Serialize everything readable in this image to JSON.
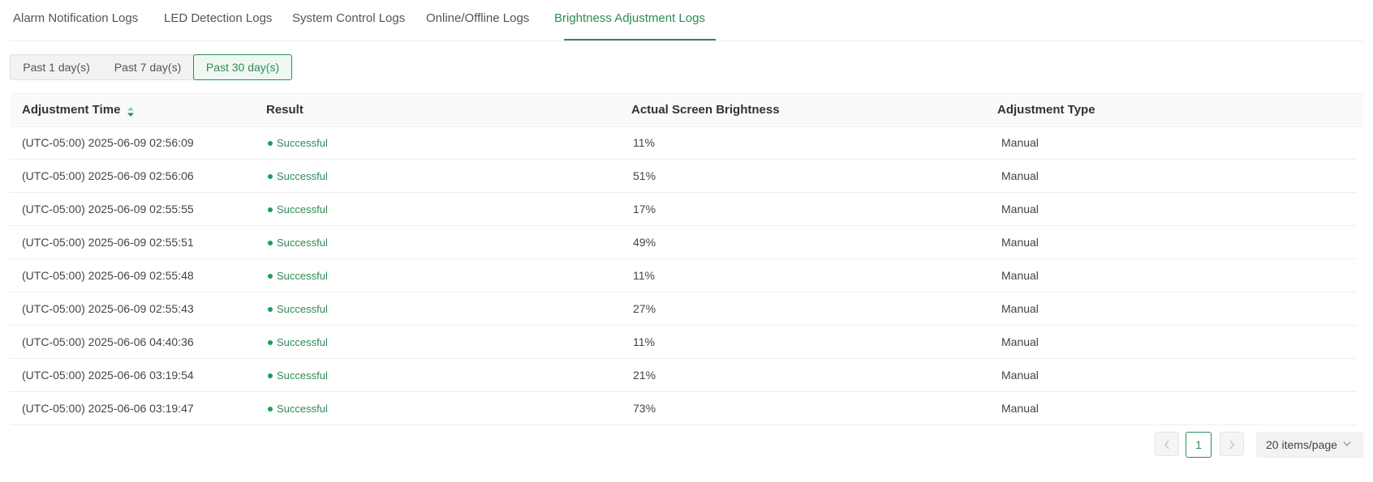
{
  "tabs": [
    {
      "label": "Alarm Notification Logs"
    },
    {
      "label": "LED Detection Logs"
    },
    {
      "label": "System Control Logs"
    },
    {
      "label": "Online/Offline Logs"
    },
    {
      "label": "Brightness Adjustment Logs",
      "active": true
    }
  ],
  "range": {
    "options": [
      "Past 1 day(s)",
      "Past 7 day(s)",
      "Past 30 day(s)"
    ],
    "selected": "Past 30 day(s)"
  },
  "table": {
    "columns": {
      "time": "Adjustment Time",
      "result": "Result",
      "brightness": "Actual Screen Brightness",
      "type": "Adjustment Type"
    },
    "sort_icon": "sort-icon",
    "rows": [
      {
        "time": "(UTC-05:00) 2025-06-09 02:56:09",
        "result": "Successful",
        "brightness": "11%",
        "type": "Manual"
      },
      {
        "time": "(UTC-05:00) 2025-06-09 02:56:06",
        "result": "Successful",
        "brightness": "51%",
        "type": "Manual"
      },
      {
        "time": "(UTC-05:00) 2025-06-09 02:55:55",
        "result": "Successful",
        "brightness": "17%",
        "type": "Manual"
      },
      {
        "time": "(UTC-05:00) 2025-06-09 02:55:51",
        "result": "Successful",
        "brightness": "49%",
        "type": "Manual"
      },
      {
        "time": "(UTC-05:00) 2025-06-09 02:55:48",
        "result": "Successful",
        "brightness": "11%",
        "type": "Manual"
      },
      {
        "time": "(UTC-05:00) 2025-06-09 02:55:43",
        "result": "Successful",
        "brightness": "27%",
        "type": "Manual"
      },
      {
        "time": "(UTC-05:00) 2025-06-06 04:40:36",
        "result": "Successful",
        "brightness": "11%",
        "type": "Manual"
      },
      {
        "time": "(UTC-05:00) 2025-06-06 03:19:54",
        "result": "Successful",
        "brightness": "21%",
        "type": "Manual"
      },
      {
        "time": "(UTC-05:00) 2025-06-06 03:19:47",
        "result": "Successful",
        "brightness": "73%",
        "type": "Manual"
      }
    ]
  },
  "pagination": {
    "current_page": "1",
    "prev_icon": "chevron-left-icon",
    "next_icon": "chevron-right-icon",
    "page_size_label": "20 items/page",
    "page_size_icon": "chevron-down-icon"
  },
  "colors": {
    "accent": "#2e8b57",
    "status_success": "#1f9d55"
  }
}
